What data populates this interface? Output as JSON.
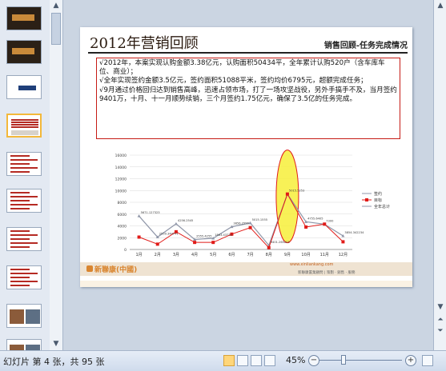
{
  "slide": {
    "title": "2012年营销回顾",
    "subtitle": "销售回顾-任务完成情况",
    "paragraphs": [
      "√2012年，本案实现认购金额3.38亿元，认购面积50434平，全年累计认购520户（含车库车位、商业）；",
      "√全年实现签约金额3.5亿元，签约面积51088平米，签约均价6795元，超额完成任务；",
      "√9月通过价格回归达到销售高峰，迅速占领市场，打了一场攻坚战役，另外手搞手不及，当月签约9401万，十月、十一月顺势续销，三个月签约1.75亿元，确保了3.5亿的任务完成。"
    ],
    "logo_text": "新聯康(中國)",
    "footer_web": "www.xinliankang.com",
    "footer_small": "新聯康置業顧問 | 策劃 · 銷售 · 服務"
  },
  "chart_data": {
    "type": "line",
    "categories": [
      "1月",
      "2月",
      "3月",
      "4月",
      "5月",
      "6月",
      "7月",
      "8月",
      "9月",
      "10月",
      "11月",
      "12月"
    ],
    "ylim": [
      0,
      16000
    ],
    "yticks": [
      0,
      2000,
      4000,
      6000,
      8000,
      10000,
      12000,
      14000,
      16000
    ],
    "series": [
      {
        "name": "签约",
        "color": "#8f96a8",
        "values": [
          5671,
          2100,
          4350,
          1700,
          1900,
          3850,
          4500,
          700,
          9401,
          4700,
          4280,
          2300
        ]
      },
      {
        "name": "目标",
        "color": "#e11b18",
        "values": [
          2100,
          900,
          3000,
          1200,
          1200,
          2600,
          3700,
          300,
          9400,
          3800,
          4300,
          1300
        ]
      }
    ],
    "data_labels": [
      "5671.127323",
      "2559.344741",
      "4256.2545",
      "2555.4255",
      "1863.43733",
      "3856.2555",
      "5015.1555",
      "9401.265205",
      "5015.5253",
      "4755.6405",
      "7300",
      "3854.342234"
    ],
    "legend": [
      "签约",
      "目标",
      "全年总计"
    ]
  },
  "thumbnails": [
    {
      "theme": "dark-title"
    },
    {
      "theme": "dark-text"
    },
    {
      "theme": "light-text"
    },
    {
      "theme": "chart",
      "active": true
    },
    {
      "theme": "red-table"
    },
    {
      "theme": "red-table"
    },
    {
      "theme": "red-table"
    },
    {
      "theme": "red-table"
    },
    {
      "theme": "photo"
    },
    {
      "theme": "photo"
    }
  ],
  "status": {
    "slide_info": "幻灯片 第 4 张，共 95 张",
    "zoom": "45%",
    "zoom_level_percent": 45
  },
  "icons": {
    "scroll_up": "triangle-up",
    "scroll_down": "triangle-down",
    "prev_slide": "double-up",
    "next_slide": "double-down",
    "zoom_out": "minus",
    "zoom_in": "plus",
    "fit": "fit-window"
  }
}
